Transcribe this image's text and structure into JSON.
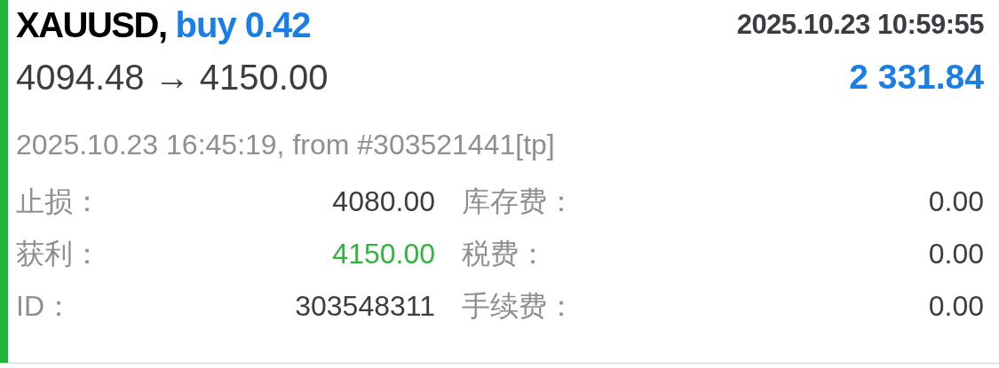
{
  "deal": {
    "symbol": "XAUUSD,",
    "action": "buy 0.42",
    "time": "2025.10.23 10:59:55",
    "prices": "4094.48 → 4150.00",
    "profit": "2 331.84",
    "open_info": "2025.10.23 16:45:19, from #303521441[tp]"
  },
  "details": [
    {
      "label": "止损：",
      "value": "4080.00",
      "color": "#3c3c43"
    },
    {
      "label": "库存费：",
      "value": "0.00",
      "color": "#3c3c43"
    },
    {
      "label": "获利：",
      "value": "4150.00",
      "color": "#2fb53f"
    },
    {
      "label": "税费：",
      "value": "0.00",
      "color": "#3c3c43"
    },
    {
      "label": "ID：",
      "value": "303548311",
      "color": "#3c3c43"
    },
    {
      "label": "手续费：",
      "value": "0.00",
      "color": "#3c3c43"
    }
  ]
}
